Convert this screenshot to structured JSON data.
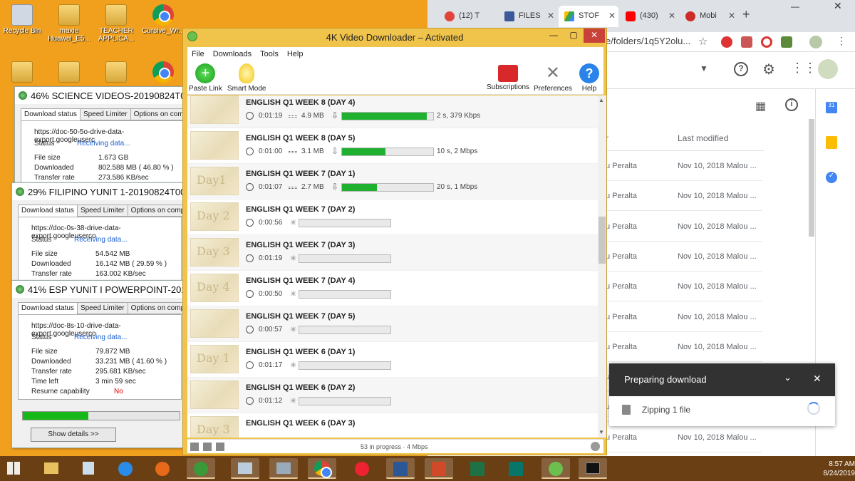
{
  "desktop": {
    "icons": [
      {
        "label": "Recycle Bin",
        "color": "#cfd8e3"
      },
      {
        "label": "maxie Huawei_E5...",
        "color": "#e9c25a"
      },
      {
        "label": "TEACHER APPLICA...",
        "color": "#e9c25a"
      },
      {
        "label": "Cursive_Wr...",
        "color": "#4285f4"
      }
    ]
  },
  "chrome": {
    "tabs": [
      {
        "label": "(12) T",
        "color": "#e0443a"
      },
      {
        "label": "FILES",
        "color": "#3b5998"
      },
      {
        "label": "STOF",
        "color": "#1fa463"
      },
      {
        "label": "(430)",
        "color": "#ff0000"
      },
      {
        "label": "Mobi",
        "color": "#cf2a2a"
      }
    ],
    "url": "e/folders/1q5Y2olu...",
    "header": {
      "col_owner": "r",
      "col_modified": "Last modified"
    },
    "rows": [
      {
        "owner": "u Peralta",
        "modified": "Nov 10, 2018 Malou ..."
      },
      {
        "owner": "u Peralta",
        "modified": "Nov 10, 2018 Malou ..."
      },
      {
        "owner": "u Peralta",
        "modified": "Nov 10, 2018 Malou ..."
      },
      {
        "owner": "u Peralta",
        "modified": "Nov 10, 2018 Malou ..."
      },
      {
        "owner": "u Peralta",
        "modified": "Nov 10, 2018 Malou ..."
      },
      {
        "owner": "u Peralta",
        "modified": "Nov 10, 2018 Malou ..."
      },
      {
        "owner": "u Peralta",
        "modified": "Nov 10, 2018 Malou ..."
      },
      {
        "owner": "u Peralta",
        "modified": "Nov 10, 2018 Malou ..."
      },
      {
        "owner": "u Peralta",
        "modified": "Nov 10, 2018 Malou ..."
      },
      {
        "owner": "u Peralta",
        "modified": "Nov 10, 2018 Malou ..."
      }
    ],
    "notification": {
      "title": "Preparing download",
      "body": "Zipping 1 file"
    }
  },
  "app": {
    "title": "4K Video Downloader – Activated",
    "menu": [
      "File",
      "Downloads",
      "Tools",
      "Help"
    ],
    "toolbar": {
      "paste": "Paste Link",
      "smart": "Smart Mode",
      "subs": "Subscriptions",
      "prefs": "Preferences",
      "help": "Help"
    },
    "items": [
      {
        "title": "ENGLISH Q1 WEEK 8 (DAY 4)",
        "duration": "0:01:19",
        "size": "4.9 MB",
        "progress": 0.93,
        "speed": "2 s, 379 Kbps",
        "thumb": ""
      },
      {
        "title": "ENGLISH Q1 WEEK 8 (DAY 5)",
        "duration": "0:01:00",
        "size": "3.1 MB",
        "progress": 0.48,
        "speed": "10 s, 2 Mbps",
        "thumb": ""
      },
      {
        "title": "ENGLISH Q1 WEEK 7 (DAY 1)",
        "duration": "0:01:07",
        "size": "2.7 MB",
        "progress": 0.38,
        "speed": "20 s, 1 Mbps",
        "thumb": "Day1"
      },
      {
        "title": "ENGLISH Q1 WEEK 7 (DAY 2)",
        "duration": "0:00:56",
        "size": "",
        "progress": 0,
        "speed": "",
        "thumb": "Day 2"
      },
      {
        "title": "ENGLISH Q1 WEEK 7 (DAY 3)",
        "duration": "0:01:19",
        "size": "",
        "progress": 0,
        "speed": "",
        "thumb": "Day 3"
      },
      {
        "title": "ENGLISH Q1 WEEK 7 (DAY 4)",
        "duration": "0:00:50",
        "size": "",
        "progress": 0,
        "speed": "",
        "thumb": "Day 4"
      },
      {
        "title": "ENGLISH Q1 WEEK 7 (DAY 5)",
        "duration": "0:00:57",
        "size": "",
        "progress": 0,
        "speed": "",
        "thumb": ""
      },
      {
        "title": "ENGLISH Q1 WEEK 6 (DAY 1)",
        "duration": "0:01:17",
        "size": "",
        "progress": 0,
        "speed": "",
        "thumb": "Day 1"
      },
      {
        "title": "ENGLISH Q1 WEEK 6 (DAY 2)",
        "duration": "0:01:12",
        "size": "",
        "progress": 0,
        "speed": "",
        "thumb": ""
      },
      {
        "title": "ENGLISH Q1 WEEK 6 (DAY 3)",
        "duration": "",
        "size": "",
        "progress": 0,
        "speed": "",
        "thumb": "Day 3"
      }
    ],
    "status": "53 in progress · 4 Mbps"
  },
  "dialogs": [
    {
      "title": "46% SCIENCE VIDEOS-20190824T00",
      "tabs": [
        "Download status",
        "Speed Limiter",
        "Options on com"
      ],
      "url": "https://doc-50-5o-drive-data-export.googleuserc",
      "status_label": "Status",
      "status": "Receiving data...",
      "file_size_label": "File size",
      "file_size": "1.673  GB",
      "downloaded_label": "Downloaded",
      "downloaded": "802.588  MB  ( 46.80 % )",
      "rate_label": "Transfer rate",
      "rate": "273.586  KB/sec"
    },
    {
      "title": "29% FILIPINO YUNIT 1-20190824T004",
      "tabs": [
        "Download status",
        "Speed Limiter",
        "Options on comp"
      ],
      "url": "https://doc-0s-38-drive-data-export.googleuserco",
      "status_label": "Status",
      "status": "Receiving data...",
      "file_size_label": "File size",
      "file_size": "54.542  MB",
      "downloaded_label": "Downloaded",
      "downloaded": "16.142  MB  ( 29.59 % )",
      "rate_label": "Transfer rate",
      "rate": "163.002  KB/sec"
    },
    {
      "title": "41% ESP YUNIT I POWERPOINT-2019",
      "tabs": [
        "Download status",
        "Speed Limiter",
        "Options on comp"
      ],
      "url": "https://doc-8s-10-drive-data-export.googleuserco",
      "status_label": "Status",
      "status": "Receiving data...",
      "file_size_label": "File size",
      "file_size": "79.872  MB",
      "downloaded_label": "Downloaded",
      "downloaded": "33.231  MB  ( 41.60 % )",
      "rate_label": "Transfer rate",
      "rate": "295.681  KB/sec",
      "time_left_label": "Time left",
      "time_left": "3 min 59 sec",
      "resume_label": "Resume capability",
      "resume": "No",
      "progress": 0.416,
      "details_button": "Show details >>"
    }
  ],
  "taskbar": {
    "time": "8:57 AM",
    "date": "8/24/2019"
  }
}
